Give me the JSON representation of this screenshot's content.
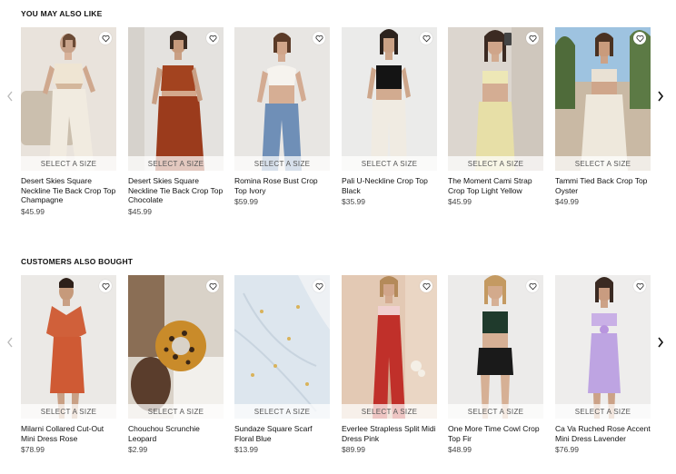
{
  "sections": [
    {
      "title": "YOU MAY ALSO LIKE",
      "size_label": "SELECT A SIZE",
      "products": [
        {
          "name": "Desert Skies Square Neckline Tie Back Crop Top Champagne",
          "price": "$45.99"
        },
        {
          "name": "Desert Skies Square Neckline Tie Back Crop Top Chocolate",
          "price": "$45.99"
        },
        {
          "name": "Romina Rose Bust Crop Top Ivory",
          "price": "$59.99"
        },
        {
          "name": "Pali U-Neckline Crop Top Black",
          "price": "$35.99"
        },
        {
          "name": "The Moment Cami Strap Crop Top Light Yellow",
          "price": "$45.99"
        },
        {
          "name": "Tammi Tied Back Crop Top Oyster",
          "price": "$49.99"
        }
      ]
    },
    {
      "title": "CUSTOMERS ALSO BOUGHT",
      "size_label": "SELECT A SIZE",
      "products": [
        {
          "name": "Milarni Collared Cut-Out Mini Dress Rose",
          "price": "$78.99"
        },
        {
          "name": "Chouchou Scrunchie Leopard",
          "price": "$2.99"
        },
        {
          "name": "Sundaze Square Scarf Floral Blue",
          "price": "$13.99"
        },
        {
          "name": "Everlee Strapless Split Midi Dress Pink",
          "price": "$89.99"
        },
        {
          "name": "One More Time Cowl Crop Top Fir",
          "price": "$48.99"
        },
        {
          "name": "Ca Va Ruched Rose Accent Mini Dress Lavender",
          "price": "$76.99"
        }
      ]
    }
  ],
  "icons": {
    "wishlist": "heart-icon",
    "prev": "chevron-left-icon",
    "next": "chevron-right-icon"
  }
}
